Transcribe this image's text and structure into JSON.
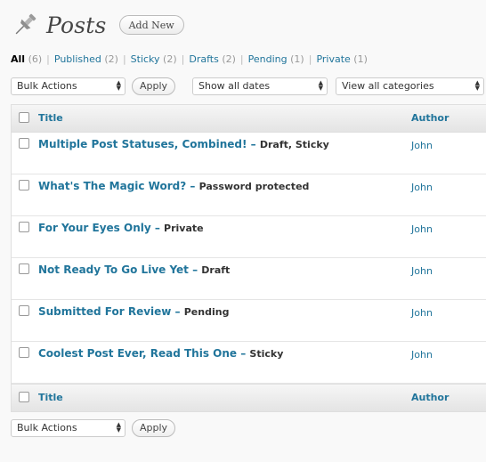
{
  "header": {
    "title": "Posts",
    "add_new_label": "Add New"
  },
  "filters": [
    {
      "label": "All",
      "count": "(6)"
    },
    {
      "label": "Published",
      "count": "(2)"
    },
    {
      "label": "Sticky",
      "count": "(2)"
    },
    {
      "label": "Drafts",
      "count": "(2)"
    },
    {
      "label": "Pending",
      "count": "(1)"
    },
    {
      "label": "Private",
      "count": "(1)"
    }
  ],
  "controls": {
    "bulk_actions": "Bulk Actions",
    "apply": "Apply",
    "dates": "Show all dates",
    "categories": "View all categories"
  },
  "table": {
    "columns": {
      "title": "Title",
      "author": "Author"
    },
    "rows": [
      {
        "title": "Multiple Post Statuses, Combined!",
        "state": "Draft, Sticky",
        "author": "John"
      },
      {
        "title": "What's The Magic Word?",
        "state": "Password protected",
        "author": "John"
      },
      {
        "title": "For Your Eyes Only",
        "state": "Private",
        "author": "John"
      },
      {
        "title": "Not Ready To Go Live Yet",
        "state": "Draft",
        "author": "John"
      },
      {
        "title": "Submitted For Review",
        "state": "Pending",
        "author": "John"
      },
      {
        "title": "Coolest Post Ever, Read This One",
        "state": "Sticky",
        "author": "John"
      }
    ]
  },
  "icons": {
    "header": "pushpin-icon",
    "select": "select-arrows-icon"
  }
}
